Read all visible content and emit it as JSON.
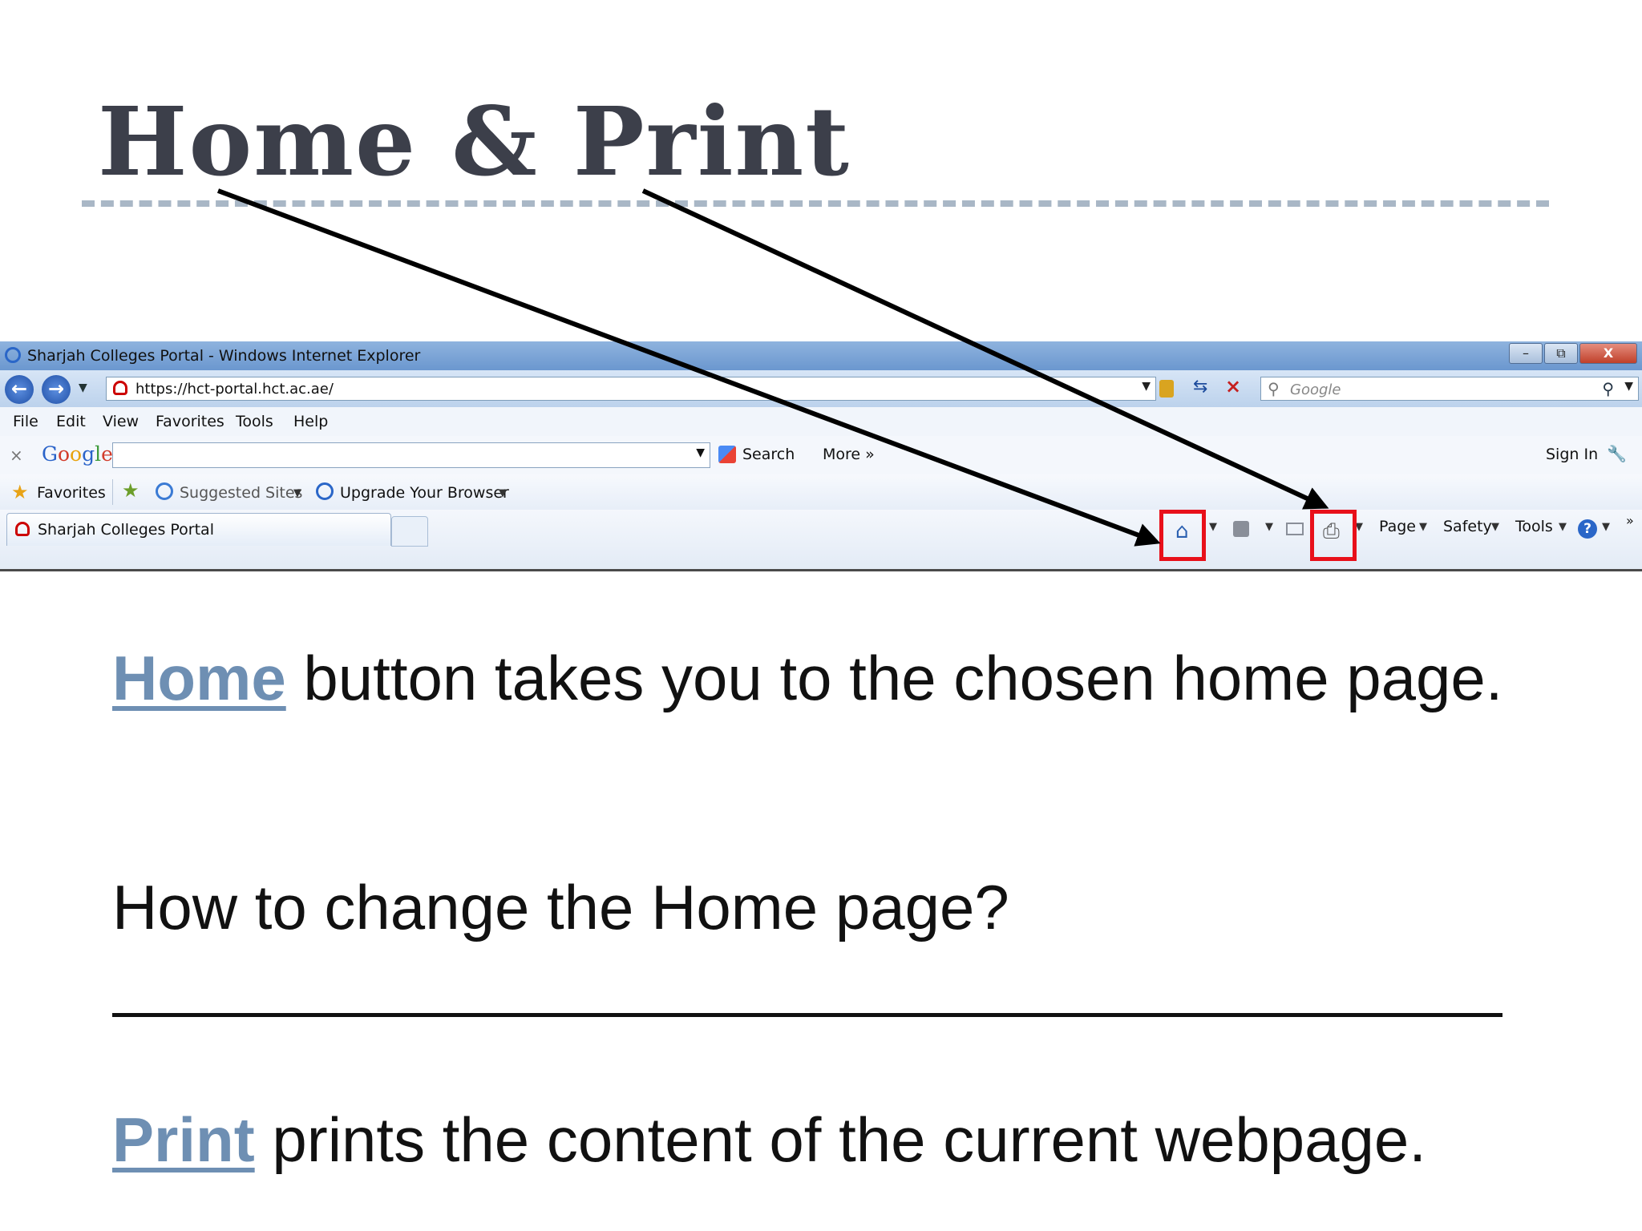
{
  "slide": {
    "title": "Home & Print"
  },
  "browser": {
    "window_title": "Sharjah Colleges Portal - Windows Internet Explorer",
    "window_buttons": {
      "minimize": "–",
      "restore": "⧉",
      "close": "X"
    },
    "address": {
      "url": "https://hct-portal.hct.ac.ae/"
    },
    "search": {
      "placeholder": "Google"
    },
    "menu": [
      "File",
      "Edit",
      "View",
      "Favorites",
      "Tools",
      "Help"
    ],
    "google_toolbar": {
      "logo": "Google",
      "search_label": "Search",
      "more_label": "More »",
      "sign_in_label": "Sign In"
    },
    "favorites_bar": {
      "favorites_label": "Favorites",
      "suggested_sites_label": "Suggested Sites",
      "upgrade_label": "Upgrade Your Browser"
    },
    "tab": {
      "label": "Sharjah Colleges Portal"
    },
    "command_bar": {
      "page_label": "Page",
      "safety_label": "Safety",
      "tools_label": "Tools",
      "help_glyph": "?",
      "overflow_glyph": "»"
    },
    "icons": [
      "home-icon",
      "feeds-icon",
      "read-mail-icon",
      "print-icon",
      "help-icon"
    ],
    "highlight_color": "#e8101a"
  },
  "content": {
    "home_keyword": "Home",
    "home_text": " button takes you to the chosen home page.",
    "question": "How to change the Home page?",
    "print_keyword": "Print",
    "print_text": " prints the content of the current webpage."
  },
  "colors": {
    "title": "#3c3f4a",
    "keyword": "#6e8fb3",
    "rule": "#a9b7c6"
  }
}
